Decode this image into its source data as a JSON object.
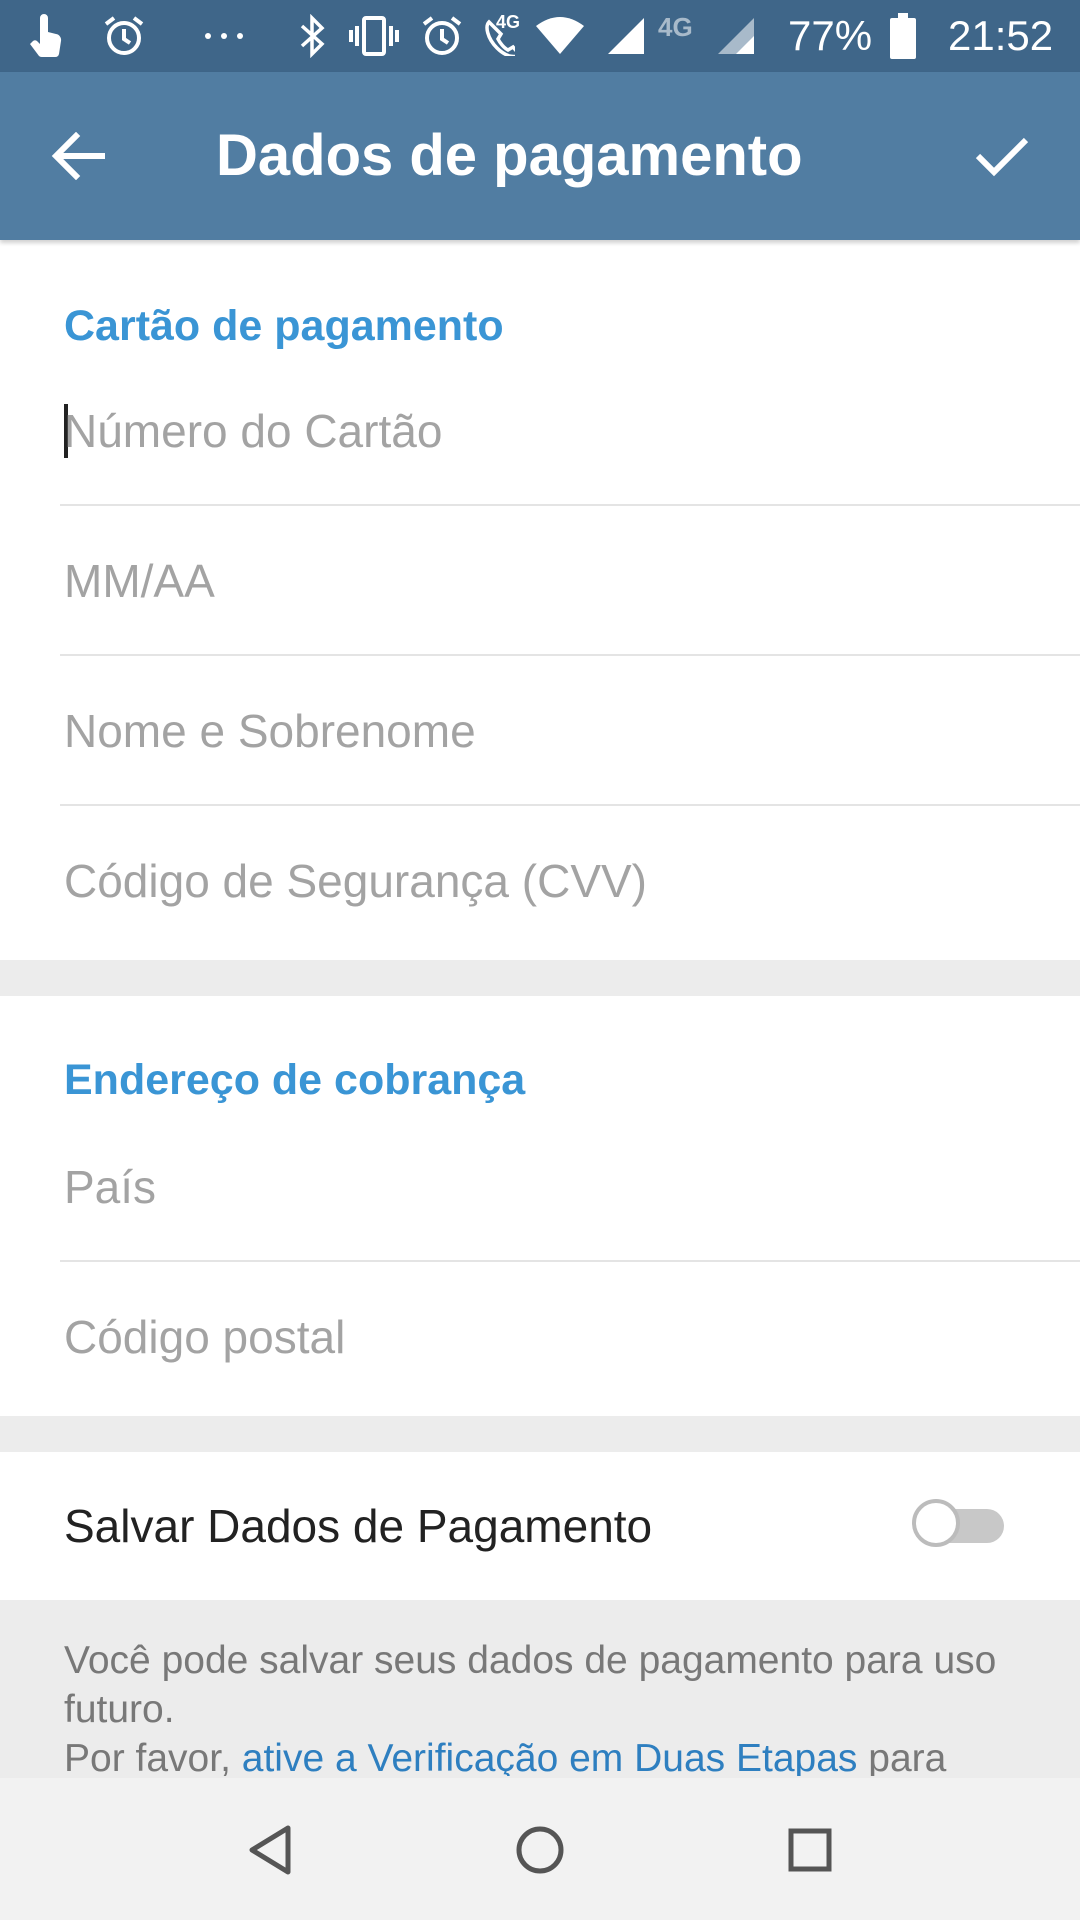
{
  "status_bar": {
    "icons": [
      "touch-hand-icon",
      "alarm-icon",
      "more-dots-icon",
      "bluetooth-icon",
      "vibrate-icon",
      "alarm-icon",
      "wifi-call-icon",
      "wifi-icon",
      "signal-icon",
      "signal-4g-icon",
      "battery-icon"
    ],
    "call_network_label": "4G",
    "network_label": "4G",
    "battery_percent": "77%",
    "time": "21:52"
  },
  "app_bar": {
    "title": "Dados de pagamento",
    "back_icon": "arrow-left-icon",
    "confirm_icon": "checkmark-icon"
  },
  "card_section": {
    "header": "Cartão de pagamento",
    "fields": [
      {
        "placeholder": "Número do Cartão",
        "value": ""
      },
      {
        "placeholder": "MM/AA",
        "value": ""
      },
      {
        "placeholder": "Nome e Sobrenome",
        "value": ""
      },
      {
        "placeholder": "Código de Segurança (CVV)",
        "value": ""
      }
    ]
  },
  "billing_section": {
    "header": "Endereço de cobrança",
    "fields": [
      {
        "placeholder": "País",
        "value": ""
      },
      {
        "placeholder": "Código postal",
        "value": ""
      }
    ]
  },
  "save_row": {
    "label": "Salvar Dados de Pagamento",
    "toggle_on": false
  },
  "info": {
    "text_1": "Você pode salvar seus dados de pagamento para uso futuro.",
    "text_2": "Por favor, ",
    "link": "ative a Verificação em Duas Etapas",
    "text_3": " para"
  },
  "nav_bar": {
    "icons": [
      "back-triangle-icon",
      "home-circle-icon",
      "recents-square-icon"
    ]
  },
  "colors": {
    "status_bar": "#3f6689",
    "app_bar": "#517da2",
    "section_header": "#3a95d5",
    "link": "#2e7fc0",
    "placeholder": "#a3a3a3",
    "background": "#ececec"
  }
}
